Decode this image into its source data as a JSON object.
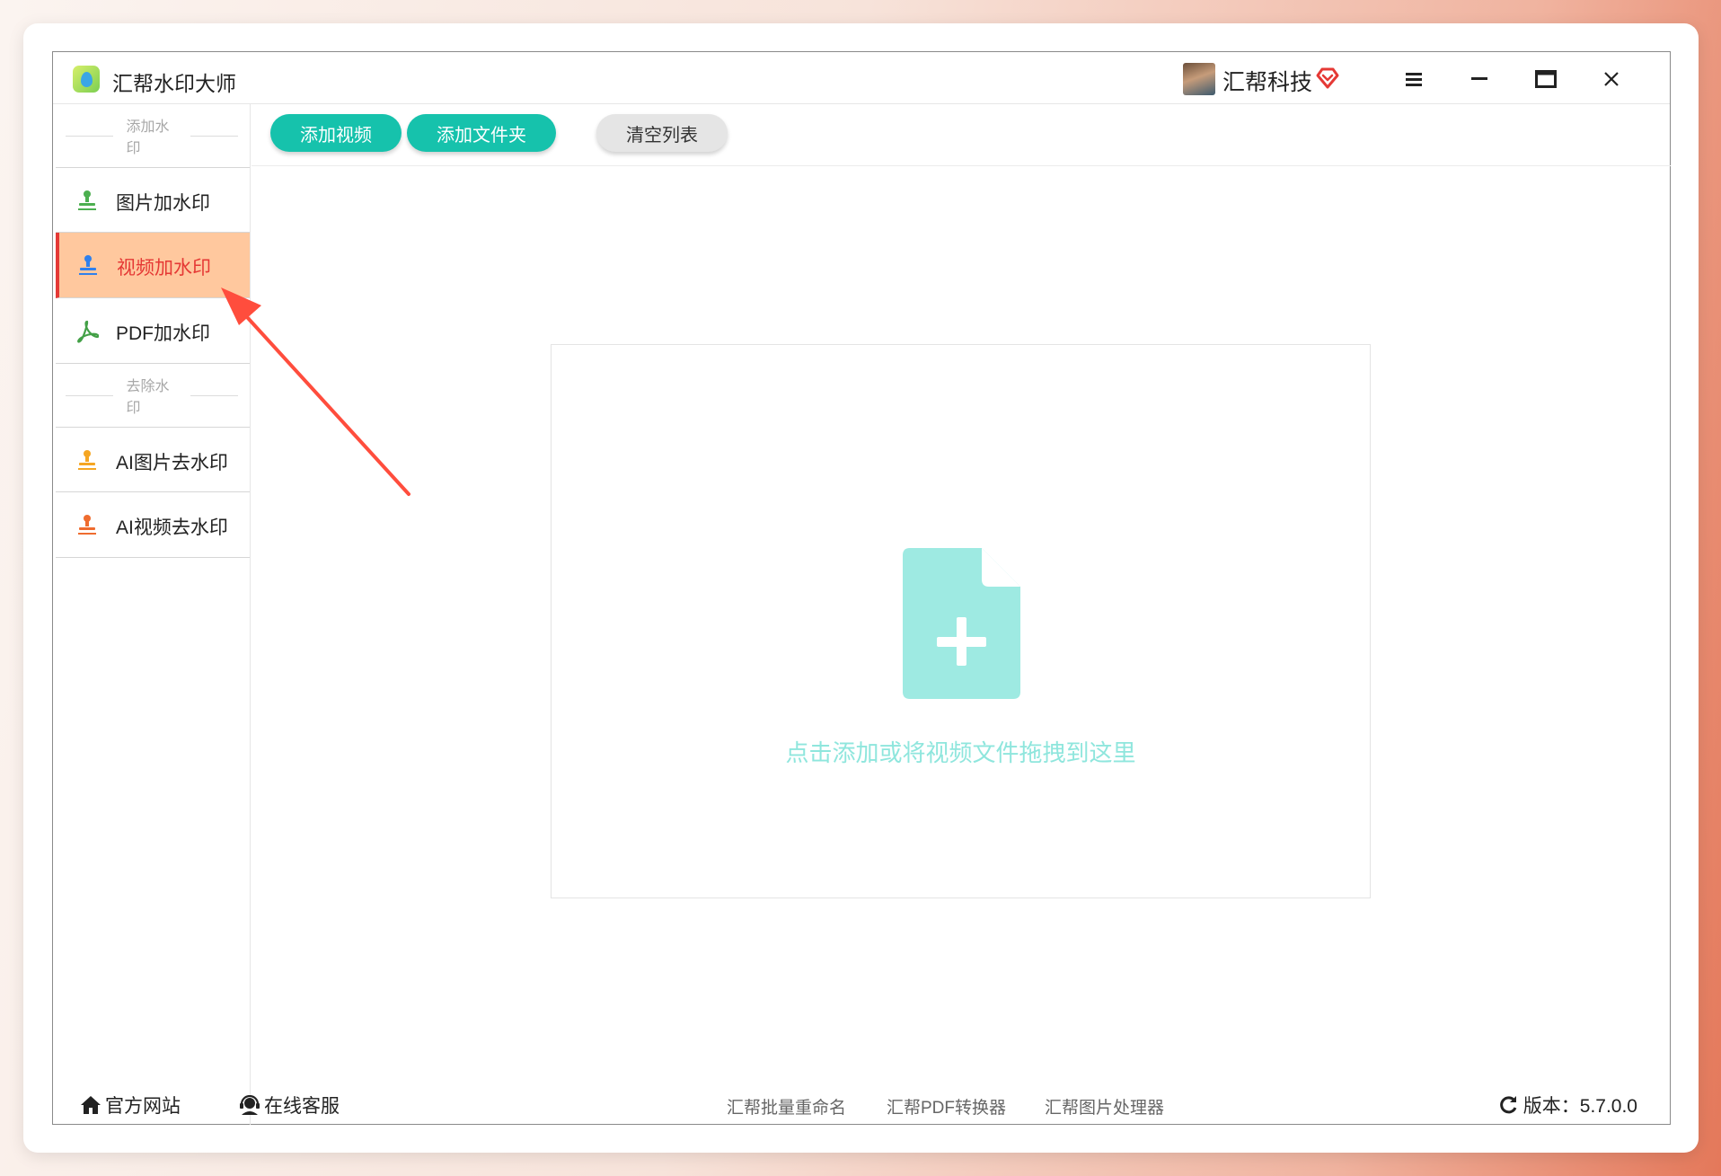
{
  "window": {
    "title": "汇帮水印大师",
    "user_name": "汇帮科技",
    "icons": {
      "app": "app-logo-icon",
      "vip": "vip-heart-icon",
      "menu": "menu-icon",
      "minimize": "minimize-icon",
      "maximize": "maximize-icon",
      "close": "close-icon"
    }
  },
  "sidebar": {
    "section_add": "添加水印",
    "section_remove": "去除水印",
    "items": [
      {
        "label": "图片加水印",
        "icon": "stamp-icon",
        "color": "#4caf50"
      },
      {
        "label": "视频加水印",
        "icon": "stamp-icon",
        "color": "#2f80ed",
        "active": true
      },
      {
        "label": "PDF加水印",
        "icon": "pdf-icon",
        "color": "#43a047"
      },
      {
        "label": "AI图片去水印",
        "icon": "stamp-icon",
        "color": "#f5a623"
      },
      {
        "label": "AI视频去水印",
        "icon": "stamp-icon",
        "color": "#ef6c2f"
      }
    ],
    "active_color": "#e53935",
    "active_bg": "#ffc89e"
  },
  "toolbar": {
    "add_video": "添加视频",
    "add_folder": "添加文件夹",
    "clear_list": "清空列表",
    "accent": "#16c2ac"
  },
  "dropzone": {
    "hint": "点击添加或将视频文件拖拽到这里",
    "icon": "file-add-icon",
    "color": "#9eeae2"
  },
  "footer": {
    "website": "官方网站",
    "support": "在线客服",
    "links": [
      "汇帮批量重命名",
      "汇帮PDF转换器",
      "汇帮图片处理器"
    ],
    "version": "版本：5.7.0.0"
  }
}
